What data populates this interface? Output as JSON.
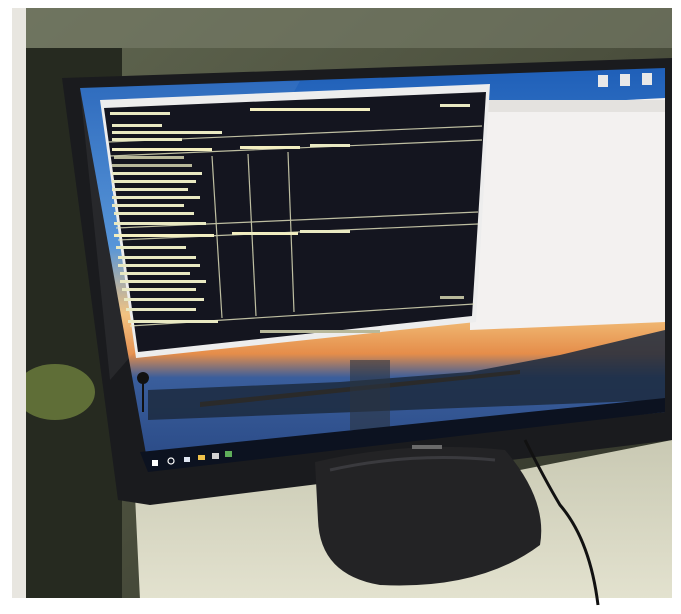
{
  "photo": {
    "kind": "photograph",
    "subject": "desktop-monitor-showing-terminal-window",
    "colors": {
      "border": "#ffffff",
      "wall": "#4b4f3d",
      "wall_dark": "#1e2119",
      "desk": "#d9d8c4",
      "monitor_bezel": "#1a1b1e",
      "monitor_stand": "#232325",
      "terminal_bg": "#14151f",
      "terminal_text": "#e9e9c2",
      "wallpaper_sky": "#2f74c9",
      "wallpaper_sunset": "#f0a55a",
      "wallpaper_water": "#3a62a6",
      "taskbar": "#0c1220",
      "white_window": "#f3f1f0",
      "cable": "#111111"
    },
    "icons": [
      "windows-start-icon",
      "search-icon",
      "task-view-icon",
      "file-explorer-icon",
      "browser-icon",
      "app-icon"
    ]
  }
}
